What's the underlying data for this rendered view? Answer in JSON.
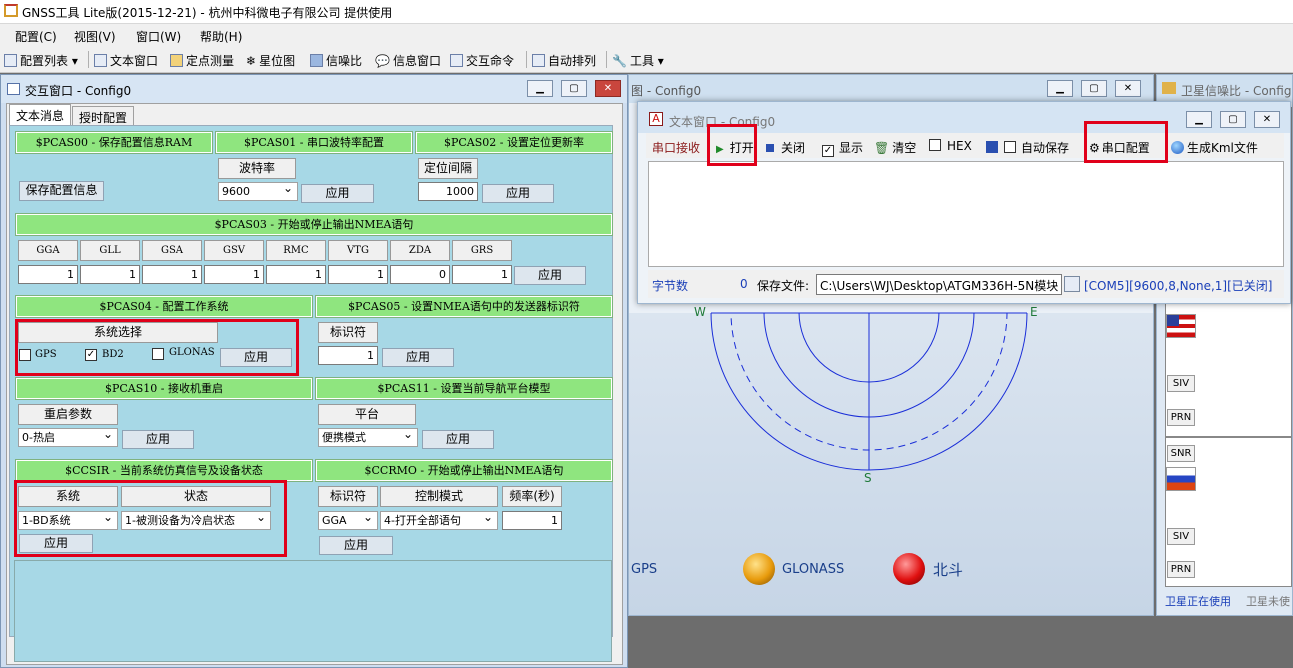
{
  "app": {
    "title": "GNSS工具 Lite版(2015-12-21) - 杭州中科微电子有限公司 提供使用"
  },
  "menu": [
    "配置(C)",
    "视图(V)",
    "窗口(W)",
    "帮助(H)"
  ],
  "toolbar": {
    "config_list": "配置列表",
    "text_window": "文本窗口",
    "fixed_point": "定点测量",
    "star_map": "星位图",
    "snr": "信噪比",
    "info_window": "信息窗口",
    "interact_cmd": "交互命令",
    "auto_arrange": "自动排列",
    "tools": "工具"
  },
  "interact": {
    "title": "交互窗口 - Config0",
    "tabs": [
      "文本消息",
      "授时配置"
    ],
    "pcas00": {
      "header": "$PCAS00 - 保存配置信息RAM",
      "button": "保存配置信息"
    },
    "pcas01": {
      "header": "$PCAS01 - 串口波特率配置",
      "label": "波特率",
      "value": "9600",
      "apply": "应用"
    },
    "pcas02": {
      "header": "$PCAS02 - 设置定位更新率",
      "label": "定位间隔",
      "value": "1000",
      "apply": "应用"
    },
    "pcas03": {
      "header": "$PCAS03 - 开始或停止输出NMEA语句",
      "cols": [
        "GGA",
        "GLL",
        "GSA",
        "GSV",
        "RMC",
        "VTG",
        "ZDA",
        "GRS"
      ],
      "vals": [
        "1",
        "1",
        "1",
        "1",
        "1",
        "1",
        "0",
        "1"
      ],
      "apply": "应用"
    },
    "pcas04": {
      "header": "$PCAS04 - 配置工作系统",
      "label": "系统选择",
      "gps": "GPS",
      "bd2": "BD2",
      "glonass": "GLONAS",
      "apply": "应用"
    },
    "pcas05": {
      "header": "$PCAS05 - 设置NMEA语句中的发送器标识符",
      "label": "标识符",
      "value": "1",
      "apply": "应用"
    },
    "pcas10": {
      "header": "$PCAS10 - 接收机重启",
      "label": "重启参数",
      "value": "0-热启",
      "apply": "应用"
    },
    "pcas11": {
      "header": "$PCAS11 - 设置当前导航平台模型",
      "label": "平台",
      "value": "便携模式",
      "apply": "应用"
    },
    "ccsir": {
      "header": "$CCSIR - 当前系统仿真信号及设备状态",
      "col1": "系统",
      "col2": "状态",
      "val1": "1-BD系统",
      "val2": "1-被测设备为冷启状态",
      "apply": "应用"
    },
    "ccrmo": {
      "header": "$CCRMO - 开始或停止输出NMEA语句",
      "col1": "标识符",
      "col2": "控制模式",
      "col3": "频率(秒)",
      "val1": "GGA",
      "val2": "4-打开全部语句",
      "val3": "1",
      "apply": "应用"
    }
  },
  "sky": {
    "title": "图 - Config0",
    "w": "W",
    "e": "E",
    "s": "S",
    "gps": "GPS",
    "glonass": "GLONASS",
    "beidou": "北斗"
  },
  "snrwin": {
    "title": "卫星信噪比 - Config",
    "siv": "SIV",
    "prn": "PRN",
    "snr": "SNR",
    "in_use": "卫星正在使用",
    "not_used": "卫星未使"
  },
  "textwin": {
    "title": "文本窗口 - Config0",
    "serial_recv": "串口接收",
    "open": "打开",
    "close": "关闭",
    "show": "显示",
    "clear": "清空",
    "hex": "HEX",
    "autosave": "自动保存",
    "serial_config": "串口配置",
    "kml": "生成Kml文件",
    "bytes_label": "字节数",
    "bytes": "0",
    "save_label": "保存文件:",
    "path": "C:\\Users\\WJ\\Desktop\\ATGM336H-5N模块",
    "port": "[COM5][9600,8,None,1][已关闭]"
  },
  "colors": {
    "header_green": "#8fe57f",
    "panel_blue": "#a7d8e6",
    "highlight_red": "#e0001a"
  }
}
